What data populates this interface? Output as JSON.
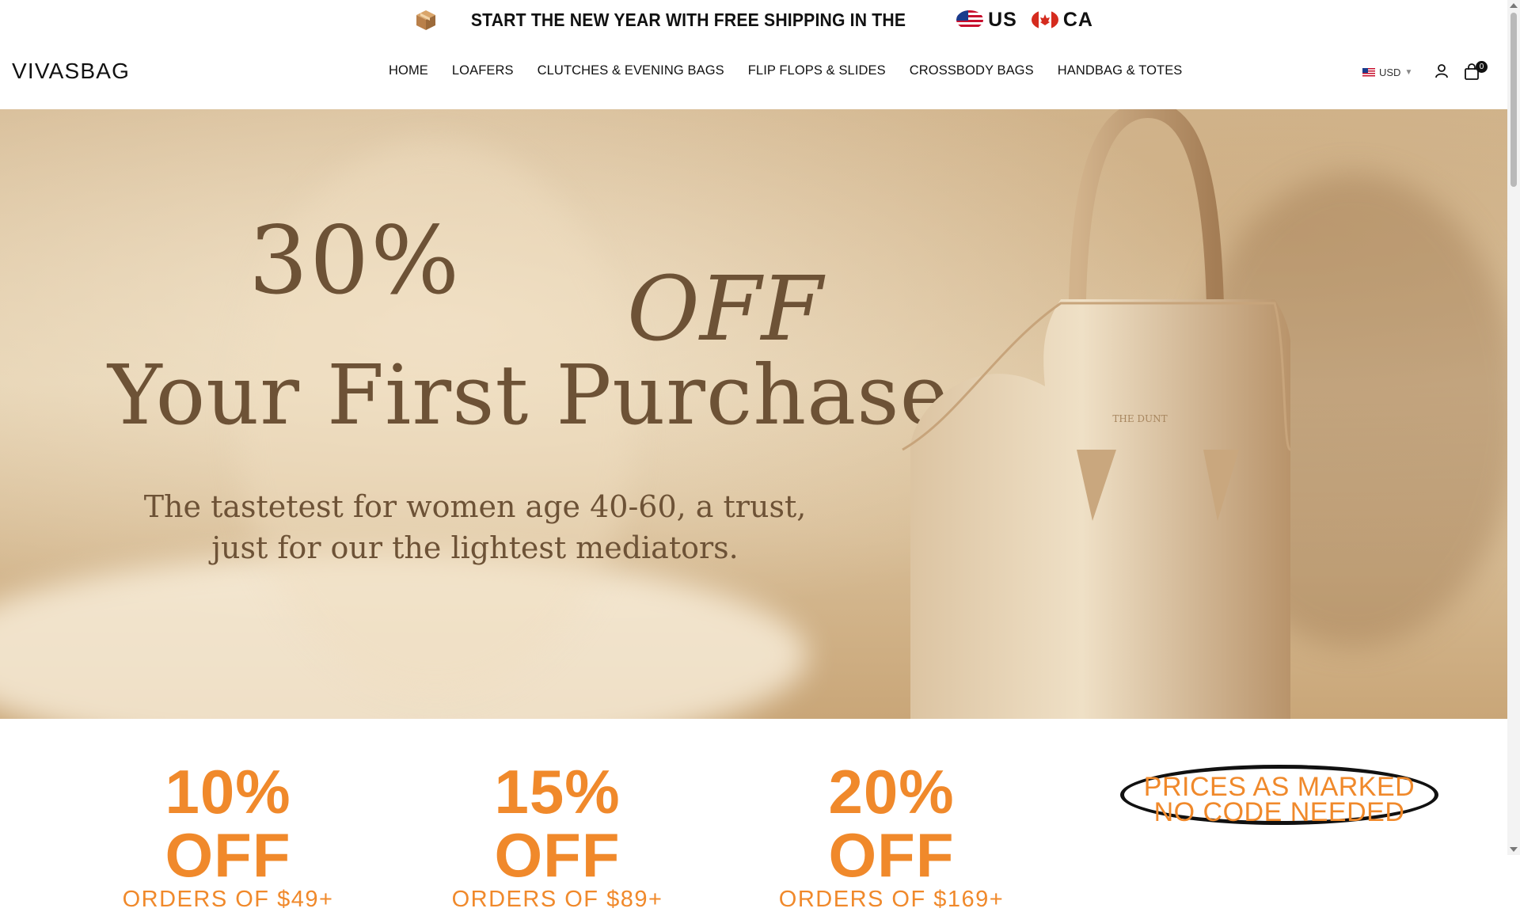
{
  "announcement": {
    "text": "START THE NEW YEAR WITH FREE SHIPPING IN THE",
    "countries": [
      {
        "code": "US",
        "flag": "us-flag-icon"
      },
      {
        "code": "CA",
        "flag": "canada-flag-icon"
      }
    ]
  },
  "header": {
    "logo": "VIVASBAG",
    "nav": [
      "HOME",
      "LOAFERS",
      "CLUTCHES & EVENING BAGS",
      "FLIP FLOPS & SLIDES",
      "CROSSBODY BAGS",
      "HANDBAG & TOTES"
    ],
    "currency": "USD",
    "cart_count": "0"
  },
  "hero": {
    "percent": "30%",
    "off": "OFF",
    "headline": "Your First Purchase",
    "subtext": "The tastetest for women age 40-60, a trust, just for our the lightest mediators."
  },
  "promos": [
    {
      "amount": "10% OFF",
      "condition": "ORDERS OF $49+"
    },
    {
      "amount": "15% OFF",
      "condition": "ORDERS OF $89+"
    },
    {
      "amount": "20% OFF",
      "condition": "ORDERS OF $169+"
    }
  ],
  "marked": {
    "line1": "PRICES AS MARKED",
    "line2": "NO CODE NEEDED"
  },
  "colors": {
    "promo_orange": "#f0892b",
    "hero_text": "#6d5236"
  }
}
